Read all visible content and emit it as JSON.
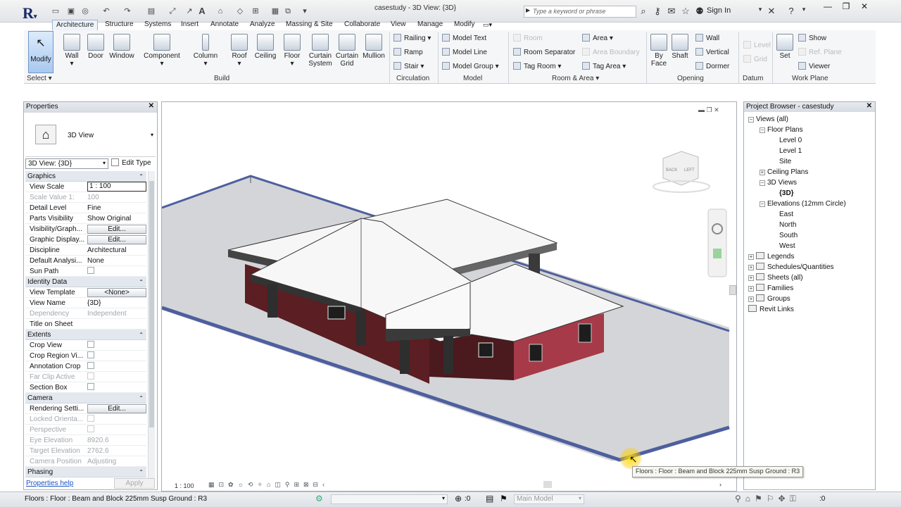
{
  "title_bar": {
    "window_title": "casestudy - 3D View: {3D}",
    "search_placeholder": "Type a keyword or phrase",
    "sign_in": "Sign In"
  },
  "tabs": [
    "Architecture",
    "Structure",
    "Systems",
    "Insert",
    "Annotate",
    "Analyze",
    "Massing & Site",
    "Collaborate",
    "View",
    "Manage",
    "Modify"
  ],
  "active_tab": "Architecture",
  "ribbon": {
    "modify": "Modify",
    "select_label": "Select",
    "build": [
      "Wall",
      "Door",
      "Window",
      "Component",
      "Column",
      "Roof",
      "Ceiling",
      "Floor",
      "Curtain System",
      "Curtain Grid",
      "Mullion"
    ],
    "build_label": "Build",
    "circulation": [
      "Railing",
      "Ramp",
      "Stair"
    ],
    "circulation_label": "Circulation",
    "model": [
      "Model Text",
      "Model Line",
      "Model Group"
    ],
    "model_label": "Model",
    "room_area": [
      "Room",
      "Room Separator",
      "Tag Room",
      "Area",
      "Area Boundary",
      "Tag Area"
    ],
    "room_area_label": "Room & Area",
    "opening": [
      "By Face",
      "Shaft",
      "Wall",
      "Vertical",
      "Dormer"
    ],
    "opening_label": "Opening",
    "datum": [
      "Level",
      "Grid"
    ],
    "datum_label": "Datum",
    "work_plane": [
      "Set",
      "Show",
      "Ref. Plane",
      "Viewer"
    ],
    "work_plane_label": "Work Plane"
  },
  "properties": {
    "header": "Properties",
    "type_name": "3D View",
    "instance_selector": "3D View: {3D}",
    "edit_type": "Edit Type",
    "groups": {
      "graphics": "Graphics",
      "identity": "Identity Data",
      "extents": "Extents",
      "camera": "Camera",
      "phasing": "Phasing"
    },
    "rows": {
      "view_scale": [
        "View Scale",
        "1 : 100"
      ],
      "scale_value": [
        "Scale Value   1:",
        "100"
      ],
      "detail_level": [
        "Detail Level",
        "Fine"
      ],
      "parts_visibility": [
        "Parts Visibility",
        "Show Original"
      ],
      "visibility_graph": [
        "Visibility/Graph...",
        "Edit..."
      ],
      "graphic_display": [
        "Graphic Display...",
        "Edit..."
      ],
      "discipline": [
        "Discipline",
        "Architectural"
      ],
      "default_analysis": [
        "Default Analysi...",
        "None"
      ],
      "sun_path": [
        "Sun Path",
        ""
      ],
      "view_template": [
        "View Template",
        "<None>"
      ],
      "view_name": [
        "View Name",
        "{3D}"
      ],
      "dependency": [
        "Dependency",
        "Independent"
      ],
      "title_on_sheet": [
        "Title on Sheet",
        ""
      ],
      "crop_view": [
        "Crop View",
        ""
      ],
      "crop_region": [
        "Crop Region Vi...",
        ""
      ],
      "annotation_crop": [
        "Annotation Crop",
        ""
      ],
      "far_clip": [
        "Far Clip Active",
        ""
      ],
      "section_box": [
        "Section Box",
        ""
      ],
      "rendering": [
        "Rendering Setti...",
        "Edit..."
      ],
      "locked_orient": [
        "Locked Orienta...",
        ""
      ],
      "perspective": [
        "Perspective",
        ""
      ],
      "eye_elevation": [
        "Eye Elevation",
        "8920.6"
      ],
      "target_elevation": [
        "Target Elevation",
        "2762.6"
      ],
      "camera_position": [
        "Camera Position",
        "Adjusting"
      ]
    },
    "help_link": "Properties help",
    "apply": "Apply"
  },
  "viewport": {
    "scale": "1 : 100",
    "viewcube_labels": [
      "BACK",
      "LEFT"
    ]
  },
  "browser": {
    "header": "Project Browser - casestudy",
    "items": [
      {
        "label": "Views (all)",
        "level": 0,
        "exp": "−"
      },
      {
        "label": "Floor Plans",
        "level": 1,
        "exp": "−"
      },
      {
        "label": "Level 0",
        "level": 2
      },
      {
        "label": "Level 1",
        "level": 2
      },
      {
        "label": "Site",
        "level": 2
      },
      {
        "label": "Ceiling Plans",
        "level": 1,
        "exp": "+"
      },
      {
        "label": "3D Views",
        "level": 1,
        "exp": "−"
      },
      {
        "label": "{3D}",
        "level": 2,
        "bold": true
      },
      {
        "label": "Elevations (12mm Circle)",
        "level": 1,
        "exp": "−"
      },
      {
        "label": "East",
        "level": 2
      },
      {
        "label": "North",
        "level": 2
      },
      {
        "label": "South",
        "level": 2
      },
      {
        "label": "West",
        "level": 2
      },
      {
        "label": "Legends",
        "level": 0,
        "exp": "+",
        "icon": true
      },
      {
        "label": "Schedules/Quantities",
        "level": 0,
        "exp": "+",
        "icon": true
      },
      {
        "label": "Sheets (all)",
        "level": 0,
        "exp": "+",
        "icon": true
      },
      {
        "label": "Families",
        "level": 0,
        "exp": "+",
        "icon": true
      },
      {
        "label": "Groups",
        "level": 0,
        "exp": "+",
        "icon": true
      },
      {
        "label": "Revit Links",
        "level": 0,
        "icon": true
      }
    ]
  },
  "status": {
    "text": "Floors : Floor : Beam and Block 225mm Susp Ground : R3",
    "tooltip": "Floors : Floor : Beam and Block 225mm Susp Ground : R3",
    "counter_left": ":0",
    "model": "Main Model",
    "counter_right": ":0"
  }
}
